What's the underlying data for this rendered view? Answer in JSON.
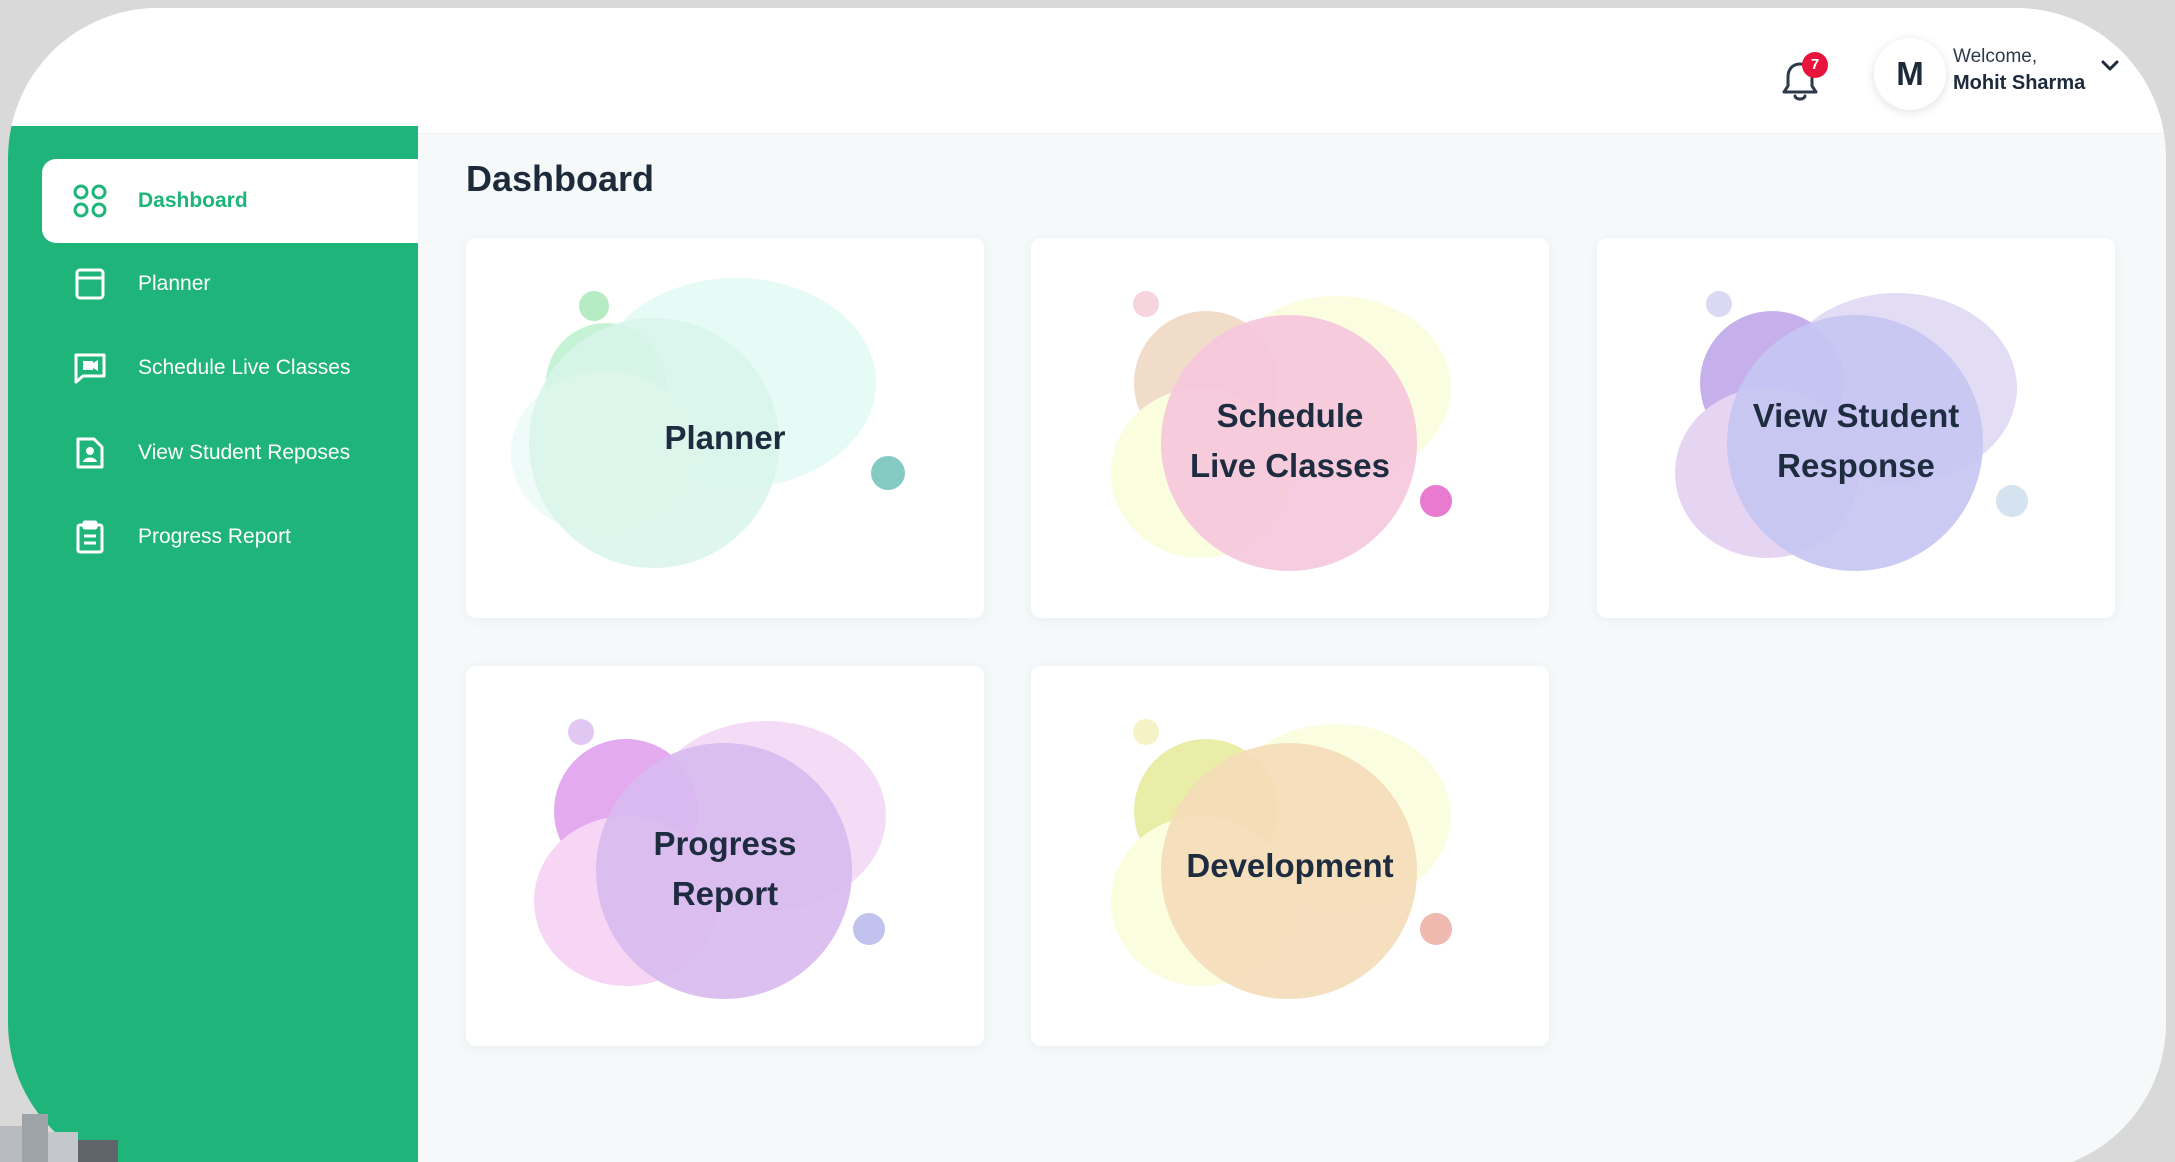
{
  "header": {
    "notification_count": "7",
    "avatar_initial": "M",
    "welcome_label": "Welcome,",
    "user_name": "Mohit Sharma"
  },
  "sidebar": {
    "items": [
      {
        "label": "Dashboard",
        "icon": "grid-circles-icon",
        "active": true
      },
      {
        "label": "Planner",
        "icon": "book-icon",
        "active": false
      },
      {
        "label": "Schedule Live Classes",
        "icon": "video-chat-icon",
        "active": false
      },
      {
        "label": "View Student Reposes",
        "icon": "student-file-icon",
        "active": false
      },
      {
        "label": "Progress Report",
        "icon": "clipboard-icon",
        "active": false
      }
    ]
  },
  "main": {
    "title": "Dashboard",
    "cards": [
      {
        "line1": "Planner",
        "line2": ""
      },
      {
        "line1": "Schedule",
        "line2": "Live Classes"
      },
      {
        "line1": "View Student",
        "line2": "Response"
      },
      {
        "line1": "Progress",
        "line2": "Report"
      },
      {
        "line1": "Development",
        "line2": ""
      }
    ]
  },
  "colors": {
    "sidebar_bg": "#1fb57a",
    "badge": "#e8143c",
    "text_dark": "#1c2a3a"
  }
}
